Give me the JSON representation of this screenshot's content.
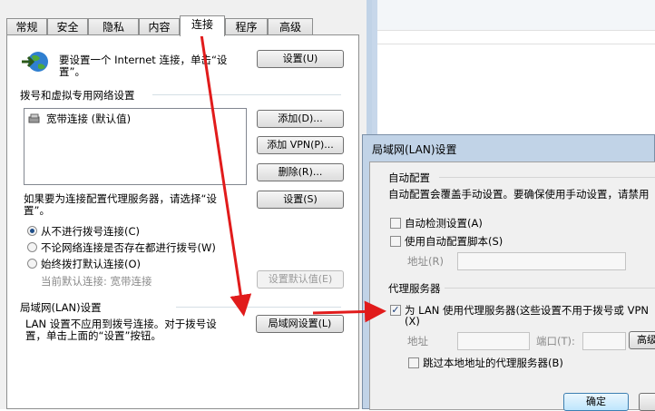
{
  "main_dialog": {
    "tabs": [
      "常规",
      "安全",
      "隐私",
      "内容",
      "连接",
      "程序",
      "高级"
    ],
    "active_tab": "连接",
    "setup_text_1": "要设置一个 Internet 连接，单击“设",
    "setup_text_2": "置”。",
    "setup_button": "设置(U)",
    "dialup_section": "拨号和虚拟专用网络设置",
    "connections": [
      {
        "label": "宽带连接 (默认值)"
      }
    ],
    "add_button": "添加(D)...",
    "add_vpn_button": "添加 VPN(P)...",
    "delete_button": "删除(R)...",
    "proxy_text_1": "如果要为连接配置代理服务器，请选择“设",
    "proxy_text_2": "置”。",
    "settings_button": "设置(S)",
    "radio_never": "从不进行拨号连接(C)",
    "radio_no_network": "不论网络连接是否存在都进行拨号(W)",
    "radio_always": "始终拨打默认连接(O)",
    "current_default": "当前默认连接: 宽带连接",
    "set_default_button": "设置默认值(E)",
    "lan_section": "局域网(LAN)设置",
    "lan_text_1": "LAN 设置不应用到拨号连接。对于拨号设",
    "lan_text_2": "置，单击上面的“设置”按钮。",
    "lan_button": "局域网设置(L)"
  },
  "lan_dialog": {
    "title": "局域网(LAN)设置",
    "auto_group": "自动配置",
    "auto_desc": "自动配置会覆盖手动设置。要确保使用手动设置，请禁用",
    "auto_detect": "自动检测设置(A)",
    "auto_script": "使用自动配置脚本(S)",
    "address_label": "地址(R)",
    "proxy_group": "代理服务器",
    "use_proxy_1": "为 LAN 使用代理服务器(这些设置不用于拨号或 VPN",
    "use_proxy_2": "(X)",
    "proxy_address": "地址",
    "port_label": "端口(T):",
    "advanced_button": "高级",
    "bypass_local": "跳过本地地址的代理服务器(B)",
    "ok_button": "确定"
  },
  "colors": {
    "arrow": "#e11b1b",
    "dialog_bg": "#f0f0f0",
    "frame": "#c1d3e7"
  }
}
